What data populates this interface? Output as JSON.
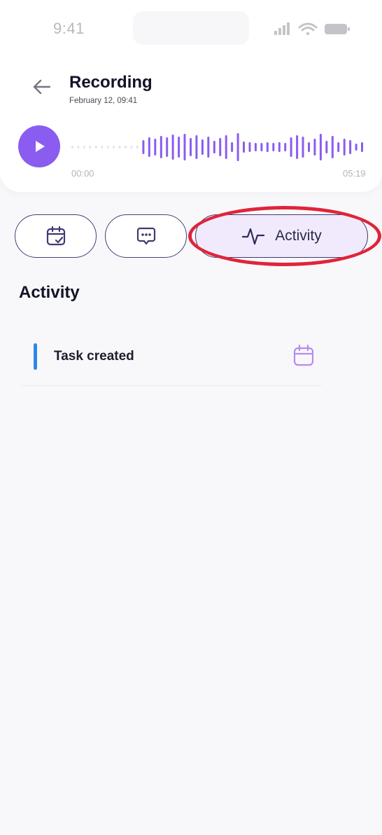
{
  "status_bar": {
    "time": "9:41",
    "icons": [
      "signal-icon",
      "wifi-icon",
      "battery-icon"
    ]
  },
  "header": {
    "back_icon": "arrow-left-icon",
    "title": "Recording",
    "subtitle": "February 12, 09:41"
  },
  "player": {
    "play_icon": "play-icon",
    "time_start": "00:00",
    "time_end": "05:19",
    "progress": 0
  },
  "tabs": [
    {
      "id": "tasks",
      "icon": "calendar-check-icon",
      "label": "",
      "selected": false
    },
    {
      "id": "chat",
      "icon": "chat-bubble-icon",
      "label": "",
      "selected": false
    },
    {
      "id": "activity",
      "icon": "activity-pulse-icon",
      "label": "Activity",
      "selected": true
    }
  ],
  "section": {
    "title": "Activity"
  },
  "activity_items": [
    {
      "label": "Task created",
      "icon": "calendar-icon",
      "marker_color": "#2f88e8"
    }
  ],
  "colors": {
    "accent": "#8a5cf0",
    "tab_border": "#433f72",
    "tab_selected_bg": "#f1eafd",
    "highlight": "#e0243a",
    "marker": "#2f88e8"
  }
}
